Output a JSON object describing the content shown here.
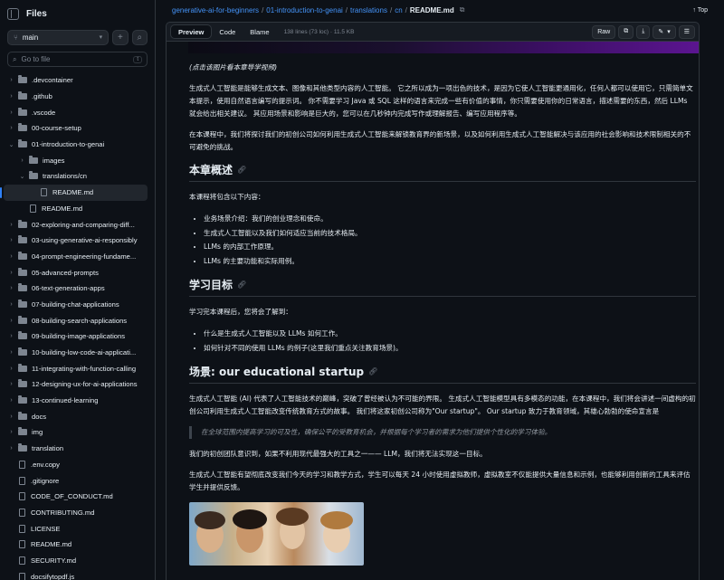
{
  "sidebar": {
    "title": "Files",
    "branch": "main",
    "add_label": "+",
    "search_placeholder": "Go to file",
    "search_shortcut": "t",
    "items": [
      {
        "label": ".devcontainer",
        "type": "folder",
        "depth": 0,
        "open": false
      },
      {
        "label": ".github",
        "type": "folder",
        "depth": 0,
        "open": false
      },
      {
        "label": ".vscode",
        "type": "folder",
        "depth": 0,
        "open": false
      },
      {
        "label": "00-course-setup",
        "type": "folder",
        "depth": 0,
        "open": false
      },
      {
        "label": "01-introduction-to-genai",
        "type": "folder",
        "depth": 0,
        "open": true
      },
      {
        "label": "images",
        "type": "folder",
        "depth": 1,
        "open": false
      },
      {
        "label": "translations/cn",
        "type": "folder",
        "depth": 1,
        "open": true
      },
      {
        "label": "README.md",
        "type": "file",
        "depth": 2,
        "selected": true
      },
      {
        "label": "README.md",
        "type": "file",
        "depth": 1
      },
      {
        "label": "02-exploring-and-comparing-diff...",
        "type": "folder",
        "depth": 0,
        "open": false
      },
      {
        "label": "03-using-generative-ai-responsibly",
        "type": "folder",
        "depth": 0,
        "open": false
      },
      {
        "label": "04-prompt-engineering-fundame...",
        "type": "folder",
        "depth": 0,
        "open": false
      },
      {
        "label": "05-advanced-prompts",
        "type": "folder",
        "depth": 0,
        "open": false
      },
      {
        "label": "06-text-generation-apps",
        "type": "folder",
        "depth": 0,
        "open": false
      },
      {
        "label": "07-building-chat-applications",
        "type": "folder",
        "depth": 0,
        "open": false
      },
      {
        "label": "08-building-search-applications",
        "type": "folder",
        "depth": 0,
        "open": false
      },
      {
        "label": "09-building-image-applications",
        "type": "folder",
        "depth": 0,
        "open": false
      },
      {
        "label": "10-building-low-code-ai-applicati...",
        "type": "folder",
        "depth": 0,
        "open": false
      },
      {
        "label": "11-integrating-with-function-calling",
        "type": "folder",
        "depth": 0,
        "open": false
      },
      {
        "label": "12-designing-ux-for-ai-applications",
        "type": "folder",
        "depth": 0,
        "open": false
      },
      {
        "label": "13-continued-learning",
        "type": "folder",
        "depth": 0,
        "open": false
      },
      {
        "label": "docs",
        "type": "folder",
        "depth": 0,
        "open": false
      },
      {
        "label": "img",
        "type": "folder",
        "depth": 0,
        "open": false
      },
      {
        "label": "translation",
        "type": "folder",
        "depth": 0,
        "open": false
      },
      {
        "label": ".env.copy",
        "type": "file",
        "depth": 0
      },
      {
        "label": ".gitignore",
        "type": "file",
        "depth": 0
      },
      {
        "label": "CODE_OF_CONDUCT.md",
        "type": "file",
        "depth": 0
      },
      {
        "label": "CONTRIBUTING.md",
        "type": "file",
        "depth": 0
      },
      {
        "label": "LICENSE",
        "type": "file",
        "depth": 0
      },
      {
        "label": "README.md",
        "type": "file",
        "depth": 0
      },
      {
        "label": "SECURITY.md",
        "type": "file",
        "depth": 0
      },
      {
        "label": "docsifytopdf.js",
        "type": "file",
        "depth": 0
      }
    ]
  },
  "breadcrumb": {
    "parts": [
      "generative-ai-for-beginners",
      "01-introduction-to-genai",
      "translations",
      "cn"
    ],
    "current": "README.md",
    "right_label": "Top"
  },
  "filebar": {
    "tabs": [
      "Preview",
      "Code",
      "Blame"
    ],
    "meta": "138 lines (73 loc) · 11.5 KB",
    "raw_label": "Raw"
  },
  "markdown": {
    "caption": "(点击该图片看本章导学视频)",
    "intro_p1": "生成式人工智能是能够生成文本、图像和其他类型内容的人工智能。 它之所以成为一项出色的技术，是因为它使人工智能更通用化，任何人都可以使用它，只需简单文本提示，使用自然语言编写的提示词。 你不需要学习 Java 或 SQL 这样的语言来完成一些有价值的事情，你只需要使用你的日常语言，描述需要的东西，然后 LLMs 就会给出相关建议。 其应用场景和影响是巨大的，您可以在几秒钟内完成写作或理解报告、编写应用程序等。",
    "intro_p2": "在本课程中，我们将探讨我们的初创公司如何利用生成式人工智能来解锁教育界的新场景，以及如何利用生成式人工智能解决与该应用的社会影响和技术限制相关的不可避免的挑战。",
    "h_overview": "本章概述",
    "overview_lead": "本课程将包含以下内容：",
    "overview_items": [
      "业务场景介绍：我们的创业理念和使命。",
      "生成式人工智能以及我们如何适应当前的技术格局。",
      "LLMs 的内部工作原理。",
      "LLMs 的主要功能和实际用例。"
    ],
    "h_goals": "学习目标",
    "goals_lead": "学习完本课程后，您将会了解到：",
    "goals_items": [
      "什么是生成式人工智能以及 LLMs 如何工作。",
      "如何针对不同的使用 LLMs 的例子(这里我们重点关注教育场景)。"
    ],
    "h_scenario": "场景: our educational startup",
    "scenario_p1": "生成式人工智能 (AI) 代表了人工智能技术的巅峰，突破了曾经被认为不可能的界限。 生成式人工智能模型具有多模态的功能，在本课程中，我们将会讲述一间虚构的初创公司利用生成式人工智能改变传统教育方式的故事。 我们将这家初创公司称为\"Our startup\"。 Our startup 致力于教育领域，其雄心勃勃的使命宣言是",
    "quote": "在全球范围内提高学习的可及性，确保公平的受教育机会，并根据每个学习者的需求为他们提供个性化的学习体验。",
    "scenario_p2": "我们的初创团队意识到，如果不利用现代最强大的工具之一—— LLM，我们将无法实现这一目标。",
    "scenario_p3": "生成式人工智能有望彻底改变我们今天的学习和教学方式，学生可以每天 24 小时使用虚拟教师，虚拟教室不仅能提供大量信息和示例，也能够利用创新的工具来评估学生并提供反馈。"
  }
}
